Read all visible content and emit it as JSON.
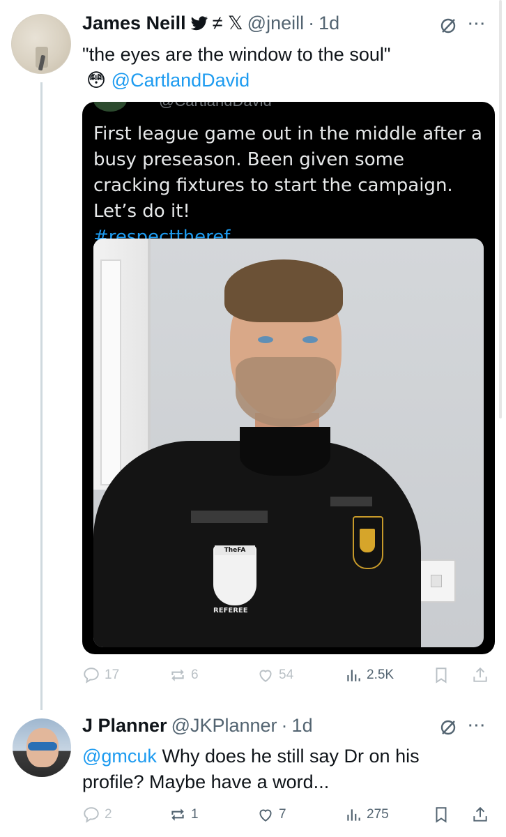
{
  "thread": {
    "tweet1": {
      "display_name": "James Neill",
      "badges": "≠ 𝕏",
      "handle": "@jneill",
      "separator": "·",
      "time": "1d",
      "text_line1": "\"the eyes are the window to the soul\"",
      "emoji": "😳",
      "mention": "@CartlandDavid",
      "quoted": {
        "handle_partial": "@CartlandDavid",
        "text": "First league game out in the middle after a busy preseason. Been given some cracking fixtures to start the campaign. Let’s do it!",
        "hashtag": "#respecttheref",
        "photo": {
          "crest_label": "TheFA",
          "shirt_label": "REFEREE"
        }
      },
      "actions": {
        "replies": "17",
        "reposts": "6",
        "likes": "54",
        "views": "2.5K"
      }
    },
    "tweet2": {
      "display_name": "J Planner",
      "handle": "@JKPlanner",
      "separator": "·",
      "time": "1d",
      "mention": "@gmcuk",
      "text_rest": " Why does he still say Dr on his profile? Maybe have a word...",
      "actions": {
        "replies": "2",
        "reposts": "1",
        "likes": "7",
        "views": "275"
      }
    }
  },
  "colors": {
    "link": "#1d9bf0",
    "muted": "#536471",
    "text": "#0f1419",
    "card_bg": "#000000"
  },
  "icons": [
    "bird-icon",
    "grok-icon",
    "more-icon",
    "reply-icon",
    "repost-icon",
    "like-icon",
    "views-icon",
    "bookmark-icon",
    "share-icon"
  ]
}
